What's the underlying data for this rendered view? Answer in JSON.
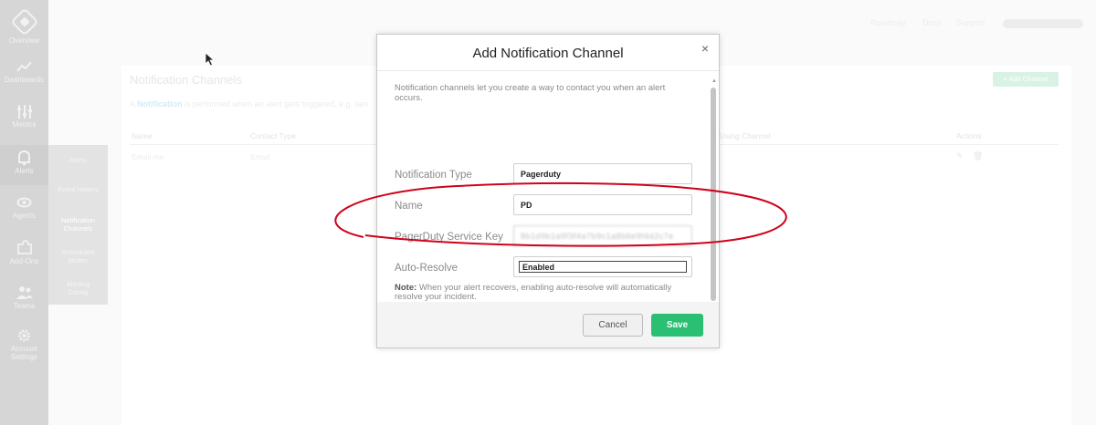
{
  "sidebar": {
    "items": [
      {
        "label": "Overview",
        "icon": "hexagon-logo-icon"
      },
      {
        "label": "Dashboards",
        "icon": "chart-line-icon"
      },
      {
        "label": "Metrics",
        "icon": "sliders-icon"
      },
      {
        "label": "Alerts",
        "icon": "bell-icon"
      },
      {
        "label": "Agents",
        "icon": "eye-icon"
      },
      {
        "label": "Add-Ons",
        "icon": "puzzle-icon"
      },
      {
        "label": "Teams",
        "icon": "users-icon"
      },
      {
        "label": "Account Settings",
        "icon": "gear-icon"
      }
    ]
  },
  "submenu": {
    "items": [
      {
        "label": "Alerts"
      },
      {
        "label": "Event History"
      },
      {
        "label": "Notification Channels"
      },
      {
        "label": "Scheduled Mutes"
      },
      {
        "label": "Alerting Config"
      }
    ]
  },
  "topnav": {
    "roadmap": "Roadmap",
    "docs": "Docs",
    "support": "Support"
  },
  "page": {
    "title": "Notification Channels",
    "desc_prefix": "A ",
    "desc_link": "Notification",
    "desc_rest": " is performed when an alert gets triggered, e.g. sen",
    "add_button": "+ Add Channel",
    "columns": [
      "Name",
      "Contact Type",
      "Using Channel",
      "Actions"
    ],
    "rows": [
      {
        "name": "Email me",
        "contact_type": "Email"
      }
    ]
  },
  "modal": {
    "title": "Add Notification Channel",
    "close": "×",
    "intro": "Notification channels let you create a way to contact you when an alert occurs.",
    "fields": {
      "type_label": "Notification Type",
      "type_value": "Pagerduty",
      "name_label": "Name",
      "name_value": "PD",
      "key_label": "PagerDuty Service Key",
      "key_value": "8b1d9b1a9f3f4a7b9c1a8b6e9f4d2c7e",
      "resolve_label": "Auto-Resolve",
      "resolve_value": "Enabled"
    },
    "note_bold": "Note:",
    "note_text": " When your alert recovers, enabling auto-resolve will automatically resolve your incident.",
    "cancel": "Cancel",
    "save": "Save"
  },
  "colors": {
    "save_green": "#2bbf73",
    "annotation_red": "#d0021b"
  }
}
